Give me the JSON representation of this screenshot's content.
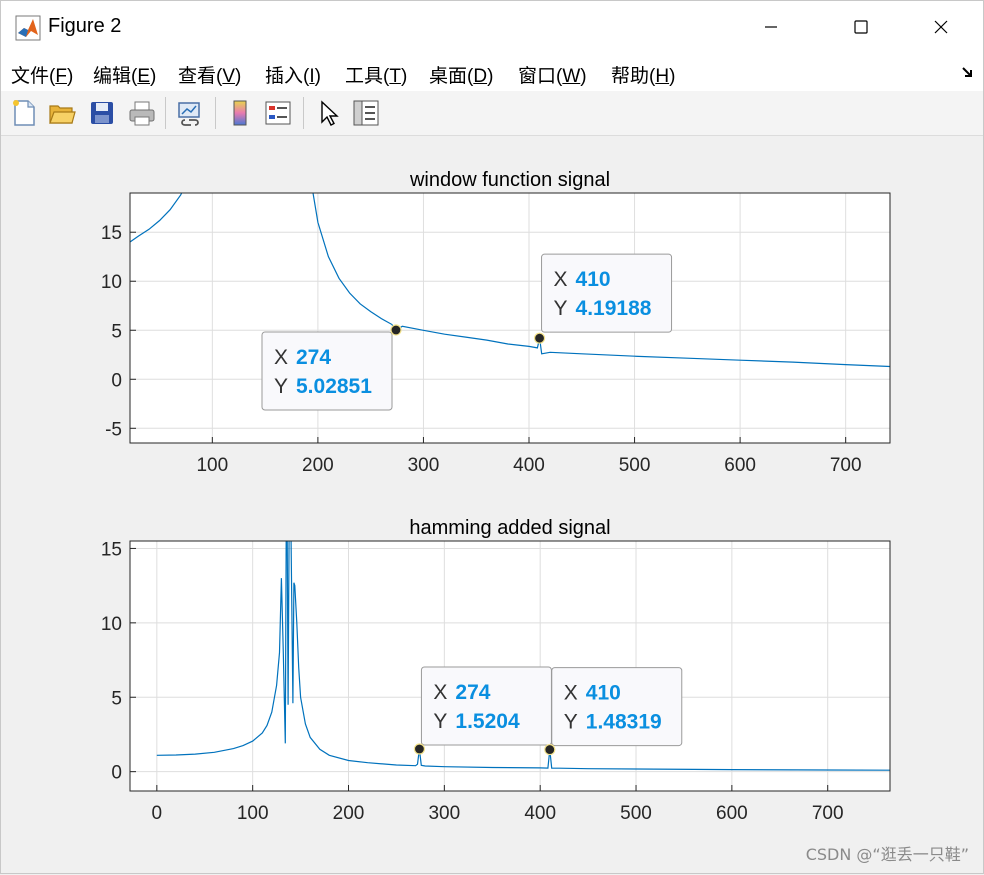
{
  "window": {
    "title": "Figure 2",
    "minimize_icon": "minimize-icon",
    "maximize_icon": "maximize-icon",
    "close_icon": "close-icon"
  },
  "menu": {
    "items": [
      {
        "label": "文件(",
        "key": "F",
        "end": ")"
      },
      {
        "label": "编辑(",
        "key": "E",
        "end": ")"
      },
      {
        "label": "查看(",
        "key": "V",
        "end": ")"
      },
      {
        "label": "插入(",
        "key": "I",
        "end": ")"
      },
      {
        "label": "工具(",
        "key": "T",
        "end": ")"
      },
      {
        "label": "桌面(",
        "key": "D",
        "end": ")"
      },
      {
        "label": "窗口(",
        "key": "W",
        "end": ")"
      },
      {
        "label": "帮助(",
        "key": "H",
        "end": ")"
      }
    ],
    "dock_icon": "dock-arrow-icon"
  },
  "toolbar": {
    "buttons": [
      "new-figure-icon",
      "open-folder-icon",
      "save-icon",
      "print-icon",
      "link-plot-icon",
      "colorbar-icon",
      "legend-icon",
      "pointer-arrow-icon",
      "property-inspector-icon"
    ]
  },
  "colors": {
    "line": "#0072BD",
    "datatip_value": "#0a8fe0",
    "grid": "#dedede"
  },
  "chart_data": [
    {
      "type": "line",
      "title": "window function signal",
      "xlim": [
        22,
        742
      ],
      "ylim": [
        -6.5,
        19
      ],
      "xticks": [
        100,
        200,
        300,
        400,
        500,
        600,
        700
      ],
      "yticks": [
        -5,
        0,
        5,
        10,
        15
      ],
      "grid": true,
      "series": [
        {
          "x": [
            22,
            30,
            40,
            50,
            60,
            70,
            80,
            90,
            100,
            110,
            120,
            130,
            140,
            150,
            160,
            170,
            180,
            190,
            200,
            210,
            220,
            230,
            240,
            250,
            260,
            270,
            274,
            280,
            300,
            320,
            340,
            360,
            380,
            400,
            408,
            410,
            412,
            420,
            450,
            500,
            550,
            600,
            650,
            700,
            742
          ],
          "y": [
            14.0,
            14.6,
            15.3,
            16.2,
            17.3,
            18.8,
            21,
            24,
            28,
            33,
            40,
            48,
            50,
            48,
            40,
            33,
            27,
            22.5,
            16,
            12.5,
            10.3,
            8.8,
            7.7,
            6.9,
            6.2,
            5.6,
            5.03,
            5.4,
            5.0,
            4.6,
            4.3,
            4.0,
            3.6,
            3.35,
            3.2,
            4.19,
            2.6,
            2.75,
            2.6,
            2.35,
            2.15,
            1.95,
            1.75,
            1.5,
            1.3
          ]
        }
      ],
      "datatips": [
        {
          "x_label": "X",
          "x_value": "274",
          "y_label": "Y",
          "y_value": "5.02851",
          "x": 274,
          "y": 5.02851
        },
        {
          "x_label": "X",
          "x_value": "410",
          "y_label": "Y",
          "y_value": "4.19188",
          "x": 410,
          "y": 4.19188
        }
      ]
    },
    {
      "type": "line",
      "title": "hamming added signal",
      "xlim": [
        -28,
        765
      ],
      "ylim": [
        -1.3,
        15.5
      ],
      "xticks": [
        0,
        100,
        200,
        300,
        400,
        500,
        600,
        700
      ],
      "yticks": [
        0,
        5,
        10,
        15
      ],
      "grid": true,
      "series": [
        {
          "x": [
            0,
            20,
            40,
            60,
            80,
            90,
            100,
            110,
            115,
            120,
            125,
            128,
            130,
            132,
            134,
            135,
            136,
            137,
            138,
            140,
            142,
            143,
            144,
            146,
            148,
            150,
            155,
            160,
            170,
            180,
            200,
            220,
            250,
            270,
            272,
            274,
            276,
            280,
            300,
            350,
            400,
            408,
            410,
            412,
            420,
            450,
            500,
            600,
            700,
            765
          ],
          "y": [
            1.1,
            1.12,
            1.18,
            1.3,
            1.55,
            1.75,
            2.05,
            2.6,
            3.1,
            4.0,
            5.8,
            8.0,
            13.0,
            8.0,
            1.9,
            16.0,
            16.0,
            4.5,
            16.0,
            16.0,
            4.6,
            12.7,
            12.5,
            10.0,
            7.0,
            5.0,
            3.2,
            2.3,
            1.5,
            1.1,
            0.75,
            0.6,
            0.45,
            0.4,
            0.5,
            1.52,
            0.42,
            0.38,
            0.33,
            0.28,
            0.25,
            0.24,
            1.48,
            0.24,
            0.23,
            0.2,
            0.18,
            0.14,
            0.11,
            0.1
          ]
        }
      ],
      "datatips": [
        {
          "x_label": "X",
          "x_value": "274",
          "y_label": "Y",
          "y_value": "1.5204",
          "x": 274,
          "y": 1.5204
        },
        {
          "x_label": "X",
          "x_value": "410",
          "y_label": "Y",
          "y_value": "1.48319",
          "x": 410,
          "y": 1.48319
        }
      ]
    }
  ],
  "watermark": "CSDN @“逛丢一只鞋”"
}
